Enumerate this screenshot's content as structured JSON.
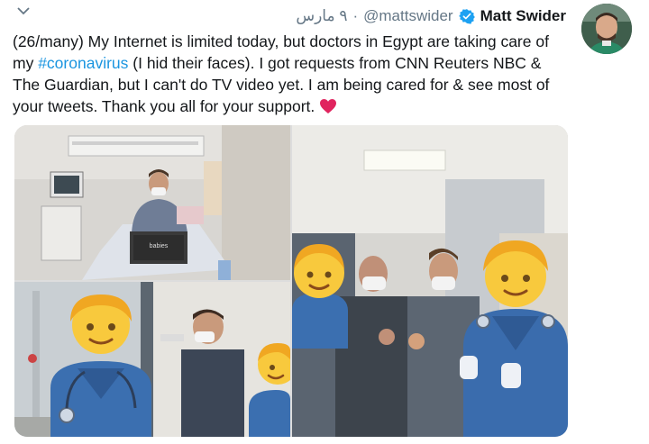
{
  "tweet": {
    "display_name": "Matt Swider",
    "handle": "@mattswider",
    "separator": "·",
    "date": "٩ مارس",
    "text_before_hashtag": "(26/many) My Internet is limited today, but doctors in Egypt are taking care of my ",
    "hashtag": "#coronavirus",
    "text_after_hashtag": " (I hid their faces). I got requests from CNN Reuters NBC & The Guardian, but I can't do TV video yet. I am being cared for & see most of your tweets. Thank you all for your support. "
  },
  "icons": {
    "menu": "chevron-down-icon",
    "verified": "verified-badge-icon",
    "heart": "red-heart-icon"
  },
  "media": {
    "photos": [
      {
        "name": "hospital-bed-laptop-photo",
        "description_icon": "photo"
      },
      {
        "name": "doctor-hallway-photo",
        "description_icon": "photo"
      },
      {
        "name": "group-thumbs-up-photo",
        "description_icon": "photo"
      }
    ],
    "laptop_sticker": "babies"
  },
  "colors": {
    "link": "#1b95e0",
    "text": "#14171a",
    "secondary": "#657786",
    "verified": "#1da1f2",
    "heart": "#e0245e"
  }
}
